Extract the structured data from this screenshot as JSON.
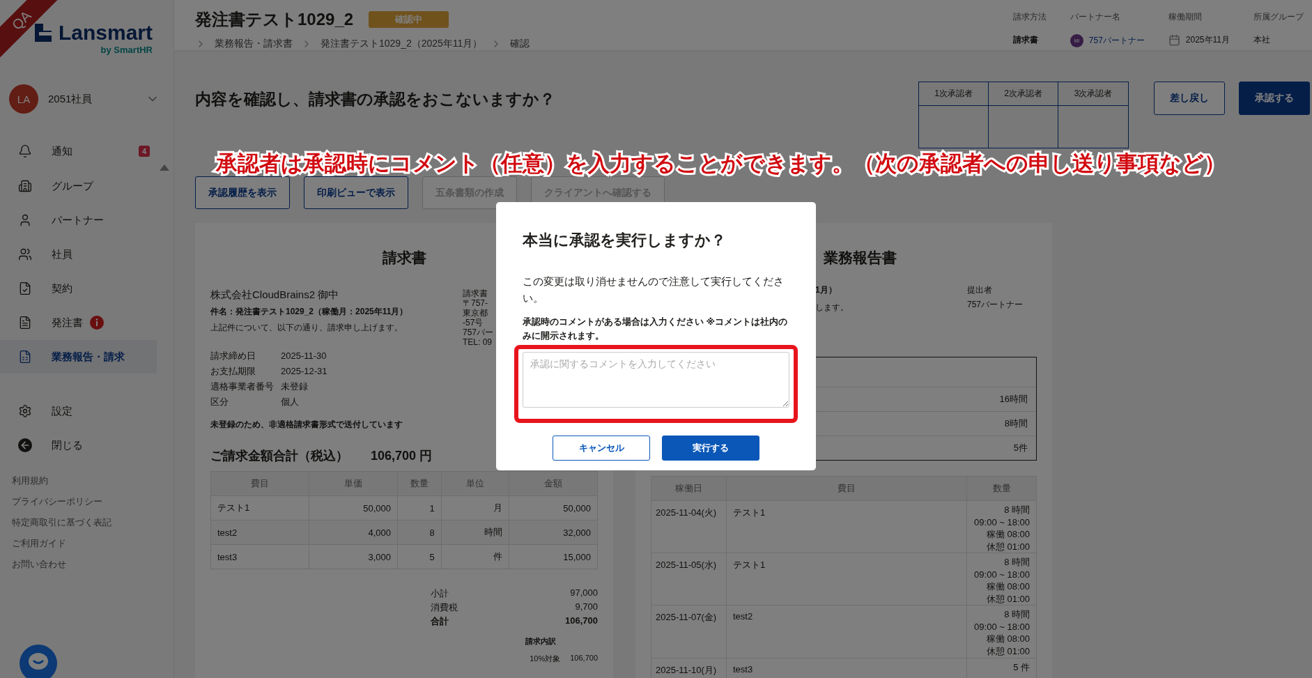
{
  "env_badge": "QA",
  "logo": {
    "name": "Lansmart",
    "sub": "by SmartHR"
  },
  "user": {
    "initials": "LA",
    "name": "2051社員"
  },
  "sidebar": {
    "items": [
      {
        "label": "通知",
        "selected": false,
        "badge": "4",
        "alert": false
      },
      {
        "label": "グループ",
        "selected": false,
        "alert": false
      },
      {
        "label": "パートナー",
        "selected": false,
        "alert": false
      },
      {
        "label": "社員",
        "selected": false,
        "alert": false
      },
      {
        "label": "契約",
        "selected": false,
        "alert": false
      },
      {
        "label": "発注書",
        "selected": false,
        "alert": true
      },
      {
        "label": "業務報告・請求",
        "selected": true,
        "alert": false
      }
    ],
    "bottom_items": [
      {
        "label": "設定"
      },
      {
        "label": "閉じる"
      }
    ],
    "links": [
      "利用規約",
      "プライバシーポリシー",
      "特定商取引に基づく表記",
      "ご利用ガイド",
      "お問い合わせ"
    ]
  },
  "header": {
    "title": "発注書テスト1029_2",
    "status": "確認中",
    "breadcrumb": [
      "業務報告・請求書",
      "発注書テスト1029_2（2025年11月）",
      "確認"
    ],
    "meta": [
      {
        "kind": "text",
        "label": "請求方法",
        "value": "請求書"
      },
      {
        "kind": "avatar",
        "label": "パートナー名",
        "value": "757パートナー",
        "initials": "MI"
      },
      {
        "kind": "date",
        "label": "稼働期間",
        "value": "2025年11月"
      },
      {
        "kind": "text",
        "label": "所属グループ",
        "value": "本社"
      }
    ]
  },
  "page": {
    "heading": "内容を確認し、請求書の承認をおこないますか？",
    "approvers": [
      "1次承認者",
      "2次承認者",
      "3次承認者"
    ],
    "buttons": [
      {
        "label": "差し戻し",
        "kind": "outline"
      },
      {
        "label": "承認する",
        "kind": "primary"
      }
    ],
    "actions": [
      {
        "label": "承認履歴を表示",
        "disabled": false
      },
      {
        "label": "印刷ビューで表示",
        "disabled": false
      },
      {
        "label": "五条書類の作成",
        "disabled": true
      },
      {
        "label": "クライアントへ確認する",
        "disabled": true
      }
    ]
  },
  "annotation": "承認者は承認時にコメント（任意）を入力することができます。（次の承認者への申し送り事項など）",
  "invoice": {
    "title": "請求書",
    "client": "株式会社CloudBrains2 御中",
    "subject": "件名：発注書テスト1029_2（稼働月：2025年11月）",
    "intro": "上記件について、以下の通り、請求申し上げます。",
    "issuer": [
      "請求書",
      "〒757-",
      "東京都",
      "-57号",
      "757パー",
      "TEL: 09"
    ],
    "fields": [
      {
        "label": "請求締め日",
        "value": "2025-11-30"
      },
      {
        "label": "お支払期限",
        "value": "2025-12-31"
      },
      {
        "label": "適格事業者番号",
        "value": "未登録"
      },
      {
        "label": "区分",
        "value": "個人"
      }
    ],
    "notice": "未登録のため、非適格請求書形式で送付しています",
    "total_label": "ご請求金額合計（税込）",
    "total_value": "106,700 円",
    "columns": [
      "費目",
      "単価",
      "数量",
      "単位",
      "金額"
    ],
    "rows": [
      [
        "テスト1",
        "50,000",
        "1",
        "月",
        "50,000"
      ],
      [
        "test2",
        "4,000",
        "8",
        "時間",
        "32,000"
      ],
      [
        "test3",
        "3,000",
        "5",
        "件",
        "15,000"
      ]
    ],
    "summary": [
      {
        "label": "小計",
        "value": "97,000",
        "bold": false
      },
      {
        "label": "消費税",
        "value": "9,700",
        "bold": false
      },
      {
        "label": "合計",
        "value": "106,700",
        "bold": true
      }
    ],
    "breakdown_title": "請求内訳",
    "breakdown": [
      {
        "label": "10%対象",
        "value": "106,700"
      }
    ]
  },
  "report": {
    "title": "業務報告書",
    "subject_tail": "1月）",
    "intro_tail": "します。",
    "submitter_label": "提出者",
    "submitter": "757パートナー",
    "summary": [
      "16時間",
      "8時間",
      "5件"
    ],
    "columns": [
      "稼働日",
      "費目",
      "数量"
    ],
    "rows": [
      {
        "date": "2025-11-04(火)",
        "item": "テスト1",
        "qty": [
          "8 時間",
          "09:00 ~ 18:00",
          "稼働 08:00",
          "休憩 01:00"
        ]
      },
      {
        "date": "2025-11-05(水)",
        "item": "テスト1",
        "qty": [
          "8 時間",
          "09:00 ~ 18:00",
          "稼働 08:00",
          "休憩 01:00"
        ]
      },
      {
        "date": "2025-11-07(金)",
        "item": "test2",
        "qty": [
          "8 時間",
          "09:00 ~ 18:00",
          "稼働 08:00",
          "休憩 01:00"
        ]
      },
      {
        "date": "2025-11-10(月)",
        "item": "test3",
        "qty": [
          "5 件"
        ]
      }
    ]
  },
  "modal": {
    "title": "本当に承認を実行しますか？",
    "message": "この変更は取り消せませんので注意して実行してください。",
    "comment_label": "承認時のコメントがある場合は入力ください ※コメントは社内のみに開示されます。",
    "placeholder": "承認に関するコメントを入力してください",
    "cancel": "キャンセル",
    "confirm": "実行する"
  }
}
